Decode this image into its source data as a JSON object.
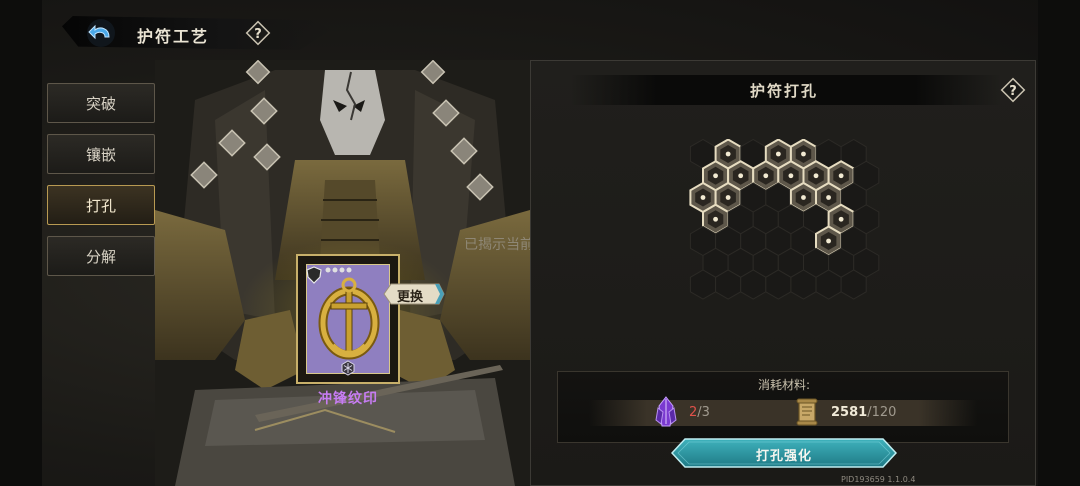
{
  "header": {
    "title": "护符工艺"
  },
  "tabs": [
    {
      "label": "突破",
      "active": false
    },
    {
      "label": "镶嵌",
      "active": false
    },
    {
      "label": "打孔",
      "active": true
    },
    {
      "label": "分解",
      "active": false
    }
  ],
  "amulet": {
    "name": "冲锋纹印",
    "replace_label": "更换"
  },
  "overlay_text": "已揭示当前 槽位状态",
  "panel": {
    "title": "护符打孔"
  },
  "materials": {
    "label": "消耗材料:",
    "crystal": {
      "have": "2",
      "need": "/3",
      "icon": "purple-crystal-icon"
    },
    "scroll": {
      "have": "2581",
      "need": "/120",
      "icon": "scroll-icon"
    }
  },
  "action": {
    "label": "打孔强化"
  },
  "version": "PID193659  1.1.0.4",
  "colors": {
    "accent_gold": "#c8b06a",
    "button_teal": "#2f9aa5",
    "amulet_purple": "#c67cf2",
    "insufficient_red": "#e0524a"
  }
}
